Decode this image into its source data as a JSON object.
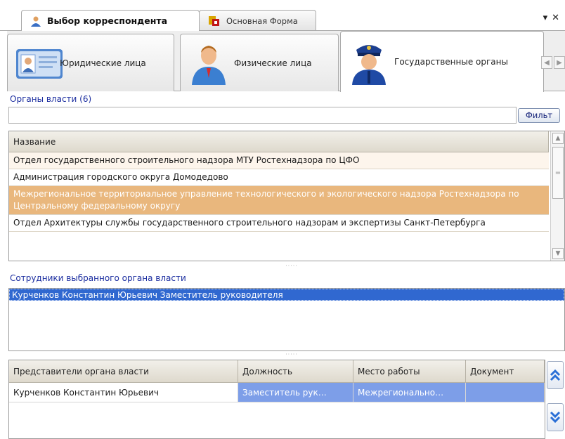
{
  "doc_tabs": [
    {
      "label": "Выбор корреспондента",
      "active": true
    },
    {
      "label": "Основная Форма",
      "active": false
    }
  ],
  "window_controls": {
    "menu": "▾",
    "close": "✕"
  },
  "category_tabs": [
    {
      "label": "Юридические лица",
      "icon": "id-card-icon"
    },
    {
      "label": "Физические лица",
      "icon": "person-icon"
    },
    {
      "label": "Государственные органы",
      "icon": "officer-icon",
      "selected": true
    }
  ],
  "organs": {
    "title": "Органы власти (6)",
    "filter_value": "",
    "filter_button": "Фильт",
    "column_header": "Название",
    "rows": [
      {
        "text": "Отдел государственного строительного надзора МТУ Ростехнадзора по ЦФО"
      },
      {
        "text": "Администрация городского округа Домодедово"
      },
      {
        "text": "Межрегиональное территориальное управление технологического и экологического надзора Ростехнадзора по Центральному федеральному округу",
        "selected": true
      },
      {
        "text": "Отдел Архитектуры службы государственного строительного надзорам и экспертизы Санкт-Петербурга"
      }
    ]
  },
  "employees": {
    "title": "Сотрудники выбранного органа власти",
    "items": [
      "Курченков Константин Юрьевич  Заместитель руководителя"
    ]
  },
  "representatives": {
    "headers": [
      "Представители органа власти",
      "Должность",
      "Место работы",
      "Документ"
    ],
    "rows": [
      [
        "Курченков Константин Юрьевич",
        "Заместитель рук…",
        "Межрегионально…",
        ""
      ]
    ]
  },
  "colors": {
    "selected_row": "#e9b77d",
    "list_selection": "#3068d0",
    "section_title": "#1c2ea0"
  }
}
